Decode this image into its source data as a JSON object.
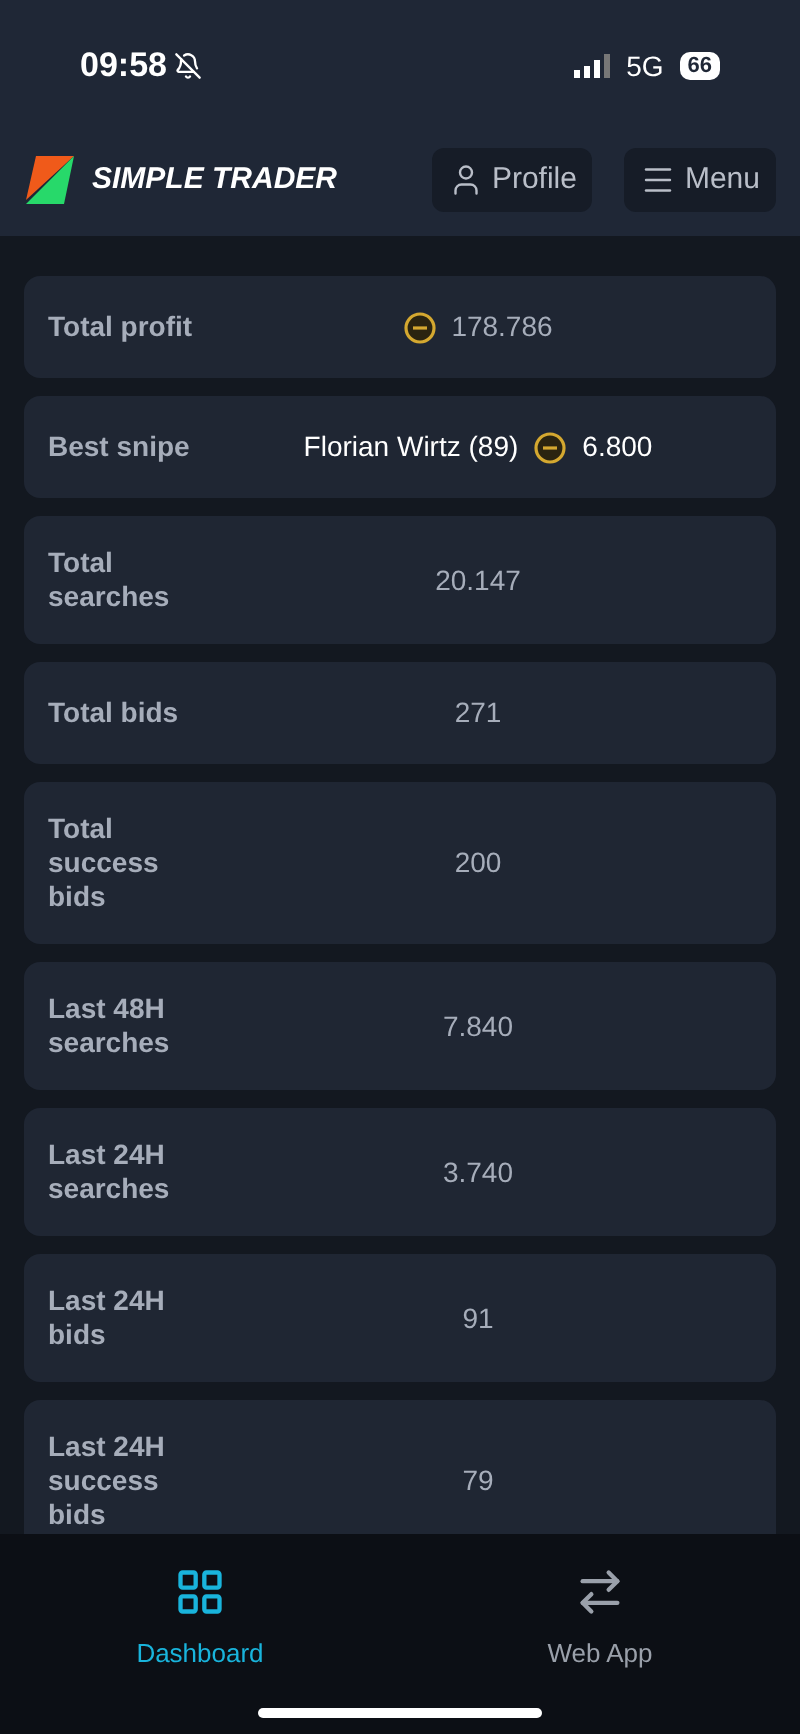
{
  "status_bar": {
    "time": "09:58",
    "network": "5G",
    "battery": "66"
  },
  "header": {
    "brand": "SIMPLE TRADER",
    "buttons": [
      {
        "kind": "profile",
        "label": "Profile"
      },
      {
        "kind": "menu",
        "label": "Menu"
      }
    ]
  },
  "stats": [
    {
      "label": "Total profit",
      "parts": [
        {
          "kind": "coin",
          "text": "178.786"
        }
      ],
      "muted": true
    },
    {
      "label": "Best snipe",
      "parts": [
        {
          "kind": "text",
          "text": "Florian Wirtz (89)"
        },
        {
          "kind": "coin",
          "text": "6.800"
        }
      ],
      "muted": false
    },
    {
      "label": "Total searches",
      "parts": [
        {
          "kind": "text",
          "text": "20.147"
        }
      ],
      "muted": true
    },
    {
      "label": "Total bids",
      "parts": [
        {
          "kind": "text",
          "text": "271"
        }
      ],
      "muted": true
    },
    {
      "label": "Total success bids",
      "parts": [
        {
          "kind": "text",
          "text": "200"
        }
      ],
      "muted": true
    },
    {
      "label": "Last 48H searches",
      "parts": [
        {
          "kind": "text",
          "text": "7.840"
        }
      ],
      "muted": true
    },
    {
      "label": "Last 24H searches",
      "parts": [
        {
          "kind": "text",
          "text": "3.740"
        }
      ],
      "muted": true
    },
    {
      "label": "Last 24H bids",
      "parts": [
        {
          "kind": "text",
          "text": "91"
        }
      ],
      "muted": true
    },
    {
      "label": "Last 24H success bids",
      "parts": [
        {
          "kind": "text",
          "text": "79"
        }
      ],
      "muted": true
    }
  ],
  "tabs": [
    {
      "kind": "dashboard",
      "label": "Dashboard",
      "selected": true
    },
    {
      "kind": "webapp",
      "label": "Web App",
      "selected": false
    }
  ]
}
